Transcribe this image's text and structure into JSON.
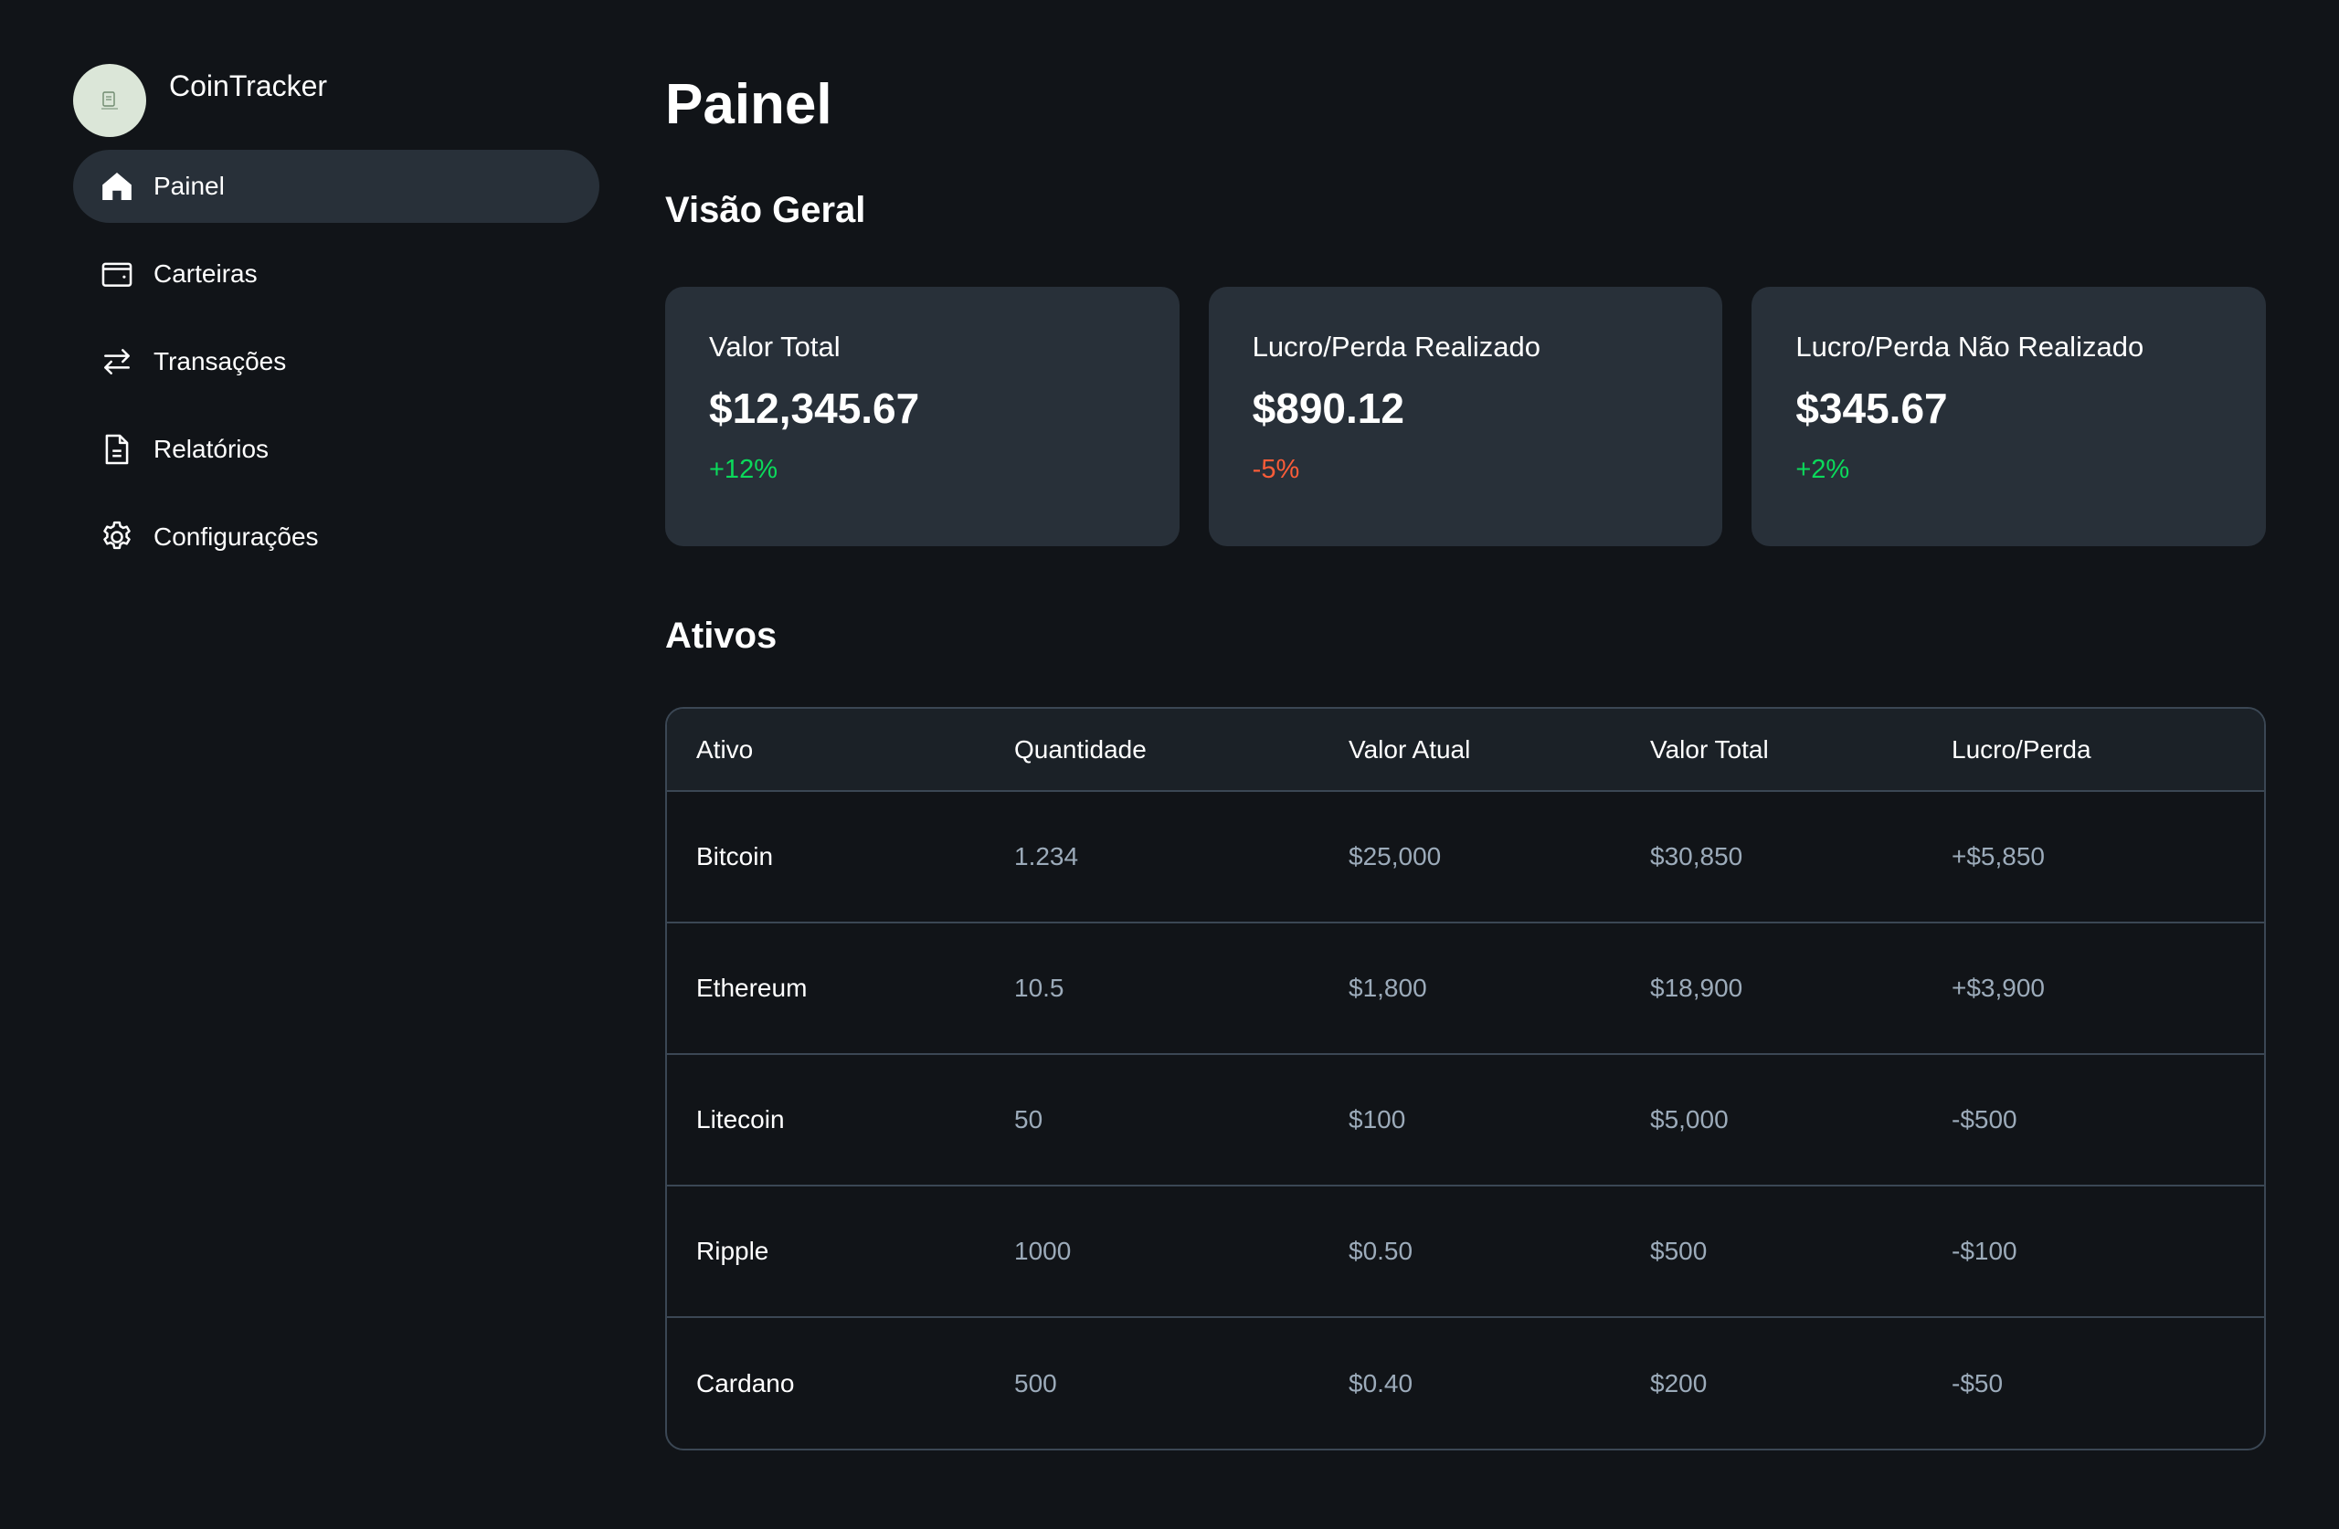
{
  "app": {
    "name": "CoinTracker"
  },
  "sidebar": {
    "items": [
      {
        "label": "Painel",
        "icon": "home-icon",
        "active": true
      },
      {
        "label": "Carteiras",
        "icon": "wallet-icon",
        "active": false
      },
      {
        "label": "Transações",
        "icon": "arrows-exchange-icon",
        "active": false
      },
      {
        "label": "Relatórios",
        "icon": "document-icon",
        "active": false
      },
      {
        "label": "Configurações",
        "icon": "gear-icon",
        "active": false
      }
    ]
  },
  "main": {
    "title": "Painel",
    "overview_title": "Visão Geral",
    "cards": [
      {
        "label": "Valor Total",
        "value": "$12,345.67",
        "change": "+12%",
        "trend": "positive"
      },
      {
        "label": "Lucro/Perda Realizado",
        "value": "$890.12",
        "change": "-5%",
        "trend": "negative"
      },
      {
        "label": "Lucro/Perda Não Realizado",
        "value": "$345.67",
        "change": "+2%",
        "trend": "positive"
      }
    ],
    "assets_title": "Ativos",
    "table": {
      "headers": [
        "Ativo",
        "Quantidade",
        "Valor Atual",
        "Valor Total",
        "Lucro/Perda"
      ],
      "rows": [
        [
          "Bitcoin",
          "1.234",
          "$25,000",
          "$30,850",
          "+$5,850"
        ],
        [
          "Ethereum",
          "10.5",
          "$1,800",
          "$18,900",
          "+$3,900"
        ],
        [
          "Litecoin",
          "50",
          "$100",
          "$5,000",
          "-$500"
        ],
        [
          "Ripple",
          "1000",
          "$0.50",
          "$500",
          "-$100"
        ],
        [
          "Cardano",
          "500",
          "$0.40",
          "$200",
          "-$50"
        ]
      ]
    }
  },
  "colors": {
    "background": "#111418",
    "card": "#283039",
    "table_header": "#1b2127",
    "border": "#3b4754",
    "muted_text": "#9cabba",
    "positive": "#0bda5b",
    "negative": "#fa5c38"
  }
}
